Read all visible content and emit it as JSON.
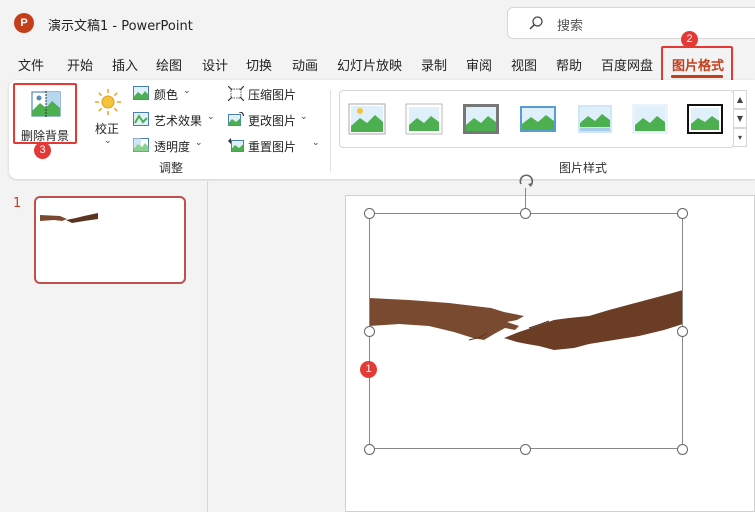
{
  "titlebar": {
    "logo": "P",
    "doc_title": "演示文稿1  -  PowerPoint",
    "search_placeholder": "搜索"
  },
  "tabs": [
    {
      "label": "文件"
    },
    {
      "label": "开始"
    },
    {
      "label": "插入"
    },
    {
      "label": "绘图"
    },
    {
      "label": "设计"
    },
    {
      "label": "切换"
    },
    {
      "label": "动画"
    },
    {
      "label": "幻灯片放映"
    },
    {
      "label": "录制"
    },
    {
      "label": "审阅"
    },
    {
      "label": "视图"
    },
    {
      "label": "帮助"
    },
    {
      "label": "百度网盘"
    },
    {
      "label": "图片格式",
      "active": true
    }
  ],
  "ribbon": {
    "remove_bg": "删除背景",
    "corrections": "校正",
    "color": "颜色",
    "artistic": "艺术效果",
    "transparency": "透明度",
    "compress": "压缩图片",
    "change": "更改图片",
    "reset": "重置图片",
    "group_adjust": "调整",
    "group_styles": "图片样式"
  },
  "annotations": {
    "badge_1": "1",
    "badge_2": "2",
    "badge_3": "3"
  },
  "slides": {
    "current_number": "1"
  },
  "colors": {
    "accent": "#c43e1c",
    "annotation_red": "#e53935"
  },
  "icons": [
    "search-icon",
    "remove-background-icon",
    "corrections-icon",
    "color-icon",
    "artistic-effects-icon",
    "transparency-icon",
    "compress-icon",
    "change-picture-icon",
    "reset-picture-icon",
    "rotate-icon"
  ]
}
